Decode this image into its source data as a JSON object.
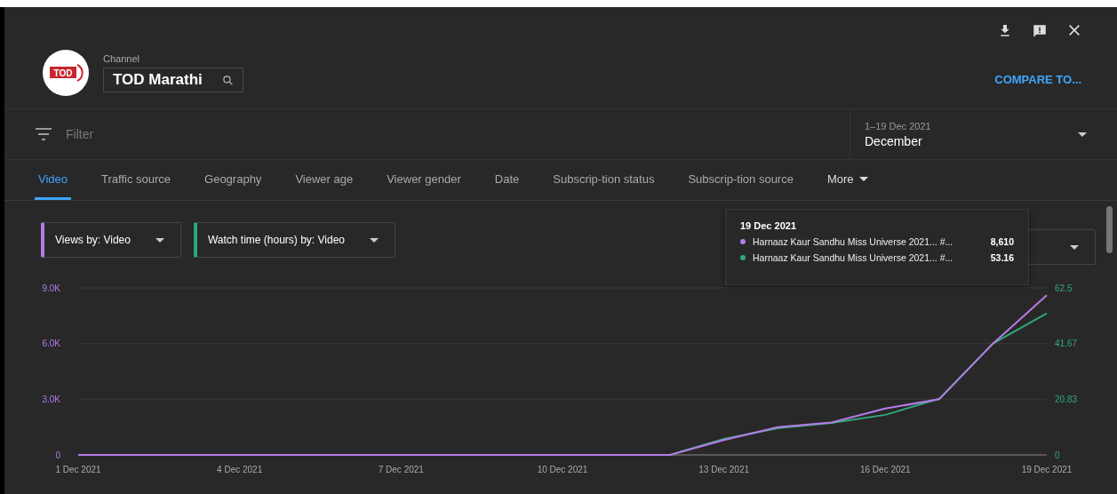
{
  "header": {
    "logo_text": "TOD",
    "channel_label": "Channel",
    "channel_value": "TOD Marathi",
    "compare_link": "COMPARE TO..."
  },
  "filter": {
    "placeholder": "Filter"
  },
  "date_range": {
    "range": "1–19 Dec 2021",
    "period": "December"
  },
  "tabs": [
    {
      "label": "Video",
      "selected": true
    },
    {
      "label": "Traffic source",
      "selected": false
    },
    {
      "label": "Geography",
      "selected": false
    },
    {
      "label": "Viewer age",
      "selected": false
    },
    {
      "label": "Viewer gender",
      "selected": false
    },
    {
      "label": "Date",
      "selected": false
    },
    {
      "label": "Subscrip-tion status",
      "selected": false
    },
    {
      "label": "Subscrip-tion source",
      "selected": false
    },
    {
      "label": "More",
      "selected": false,
      "kind": "menu"
    }
  ],
  "metric_dropdowns": [
    {
      "kind": "metric",
      "label": "Views by: Video",
      "color": "#b67be8"
    },
    {
      "kind": "metric",
      "label": "Watch time (hours) by: Video",
      "color": "#2ea879"
    },
    {
      "kind": "covered"
    }
  ],
  "tooltip": {
    "date": "19 Dec 2021",
    "rows": [
      {
        "label": "Harnaaz Kaur Sandhu Miss Universe 2021... #...",
        "value": "8,610",
        "color": "#b67be8"
      },
      {
        "label": "Harnaaz Kaur Sandhu Miss Universe 2021... #...",
        "value": "53.16",
        "color": "#2ea879"
      }
    ]
  },
  "chart_data": {
    "type": "line",
    "categories": [
      "1 Dec 2021",
      null,
      null,
      "4 Dec 2021",
      null,
      null,
      "7 Dec 2021",
      null,
      null,
      "10 Dec 2021",
      null,
      null,
      "13 Dec 2021",
      null,
      null,
      "16 Dec 2021",
      null,
      null,
      "19 Dec 2021"
    ],
    "ylim": [
      0,
      9000
    ],
    "yticks": [
      {
        "value": 0,
        "label": "0"
      },
      {
        "value": 3000,
        "label": "3.0K"
      },
      {
        "value": 6000,
        "label": "6.0K"
      },
      {
        "value": 9000,
        "label": "9.0K"
      }
    ],
    "y2lim": [
      0,
      62.5
    ],
    "y2ticks": [
      {
        "value": 0,
        "label": "0"
      },
      {
        "value": 20.83,
        "label": "20.83"
      },
      {
        "value": 41.67,
        "label": "41.67"
      },
      {
        "value": 62.5,
        "label": "62.5"
      }
    ],
    "series": [
      {
        "color": "#b67be8",
        "values": [
          0,
          0,
          0,
          0,
          0,
          0,
          0,
          0,
          0,
          0,
          0,
          0,
          800,
          1500,
          1750,
          2500,
          3000,
          6000,
          8600
        ]
      },
      {
        "color": "#2ea879",
        "axis": "y2",
        "values": [
          null,
          null,
          null,
          null,
          null,
          null,
          null,
          null,
          null,
          null,
          null,
          0,
          6,
          10,
          12,
          15,
          21,
          41.7,
          53
        ]
      }
    ]
  }
}
